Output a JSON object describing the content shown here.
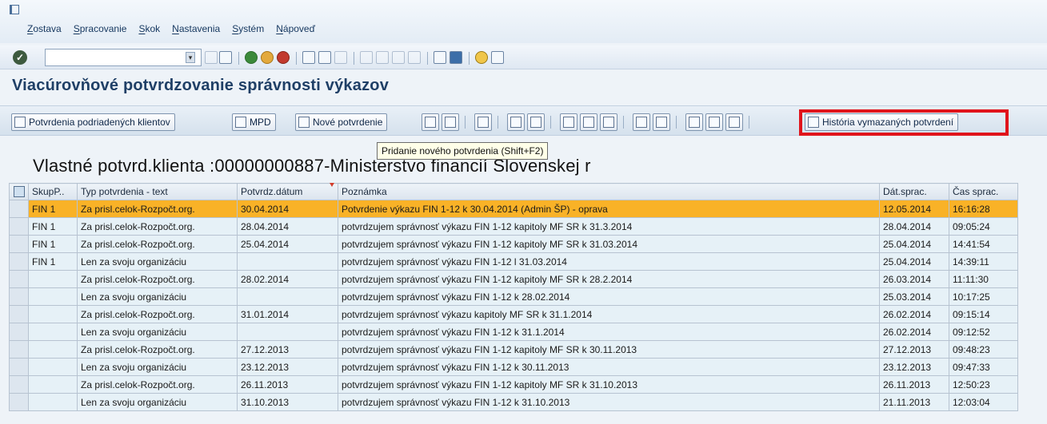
{
  "menu": [
    "Zostava",
    "Spracovanie",
    "Skok",
    "Nastavenia",
    "Systém",
    "Nápoveď"
  ],
  "command_field": {
    "value": ""
  },
  "title": "Viacúrovňové potvrdzovanie správnosti výkazov",
  "app_toolbar": {
    "btn_sub_clients": "Potvrdenia podriadených klientov",
    "btn_mpd": "MPD",
    "btn_new": "Nové potvrdenie",
    "btn_history": "História vymazaných potvrdení"
  },
  "tooltip": "Pridanie nového potvrdenia   (Shift+F2)",
  "list_heading": "Vlastné potvrd.klienta :00000000887-Ministerstvo financií Slovenskej r",
  "table": {
    "headers": [
      "SkupP..",
      "Typ potvrdenia - text",
      "Potvrdz.dátum",
      "Poznámka",
      "Dát.sprac.",
      "Čas sprac."
    ],
    "rows": [
      [
        "FIN 1",
        "Za prisl.celok-Rozpočt.org.",
        "30.04.2014",
        "Potvrdenie výkazu FIN 1-12 k 30.04.2014 (Admin ŠP) - oprava",
        "12.05.2014",
        "16:16:28"
      ],
      [
        "FIN 1",
        "Za prisl.celok-Rozpočt.org.",
        "28.04.2014",
        "potvrdzujem správnosť výkazu FIN 1-12 kapitoly MF SR k 31.3.2014",
        "28.04.2014",
        "09:05:24"
      ],
      [
        "FIN 1",
        "Za prisl.celok-Rozpočt.org.",
        "25.04.2014",
        "potvrdzujem správnosť výkazu FIN 1-12 kapitoly MF SR k 31.03.2014",
        "25.04.2014",
        "14:41:54"
      ],
      [
        "FIN 1",
        "Len za svoju organizáciu",
        "",
        "potvrdzujem správnosť výkazu FIN 1-12 l 31.03.2014",
        "25.04.2014",
        "14:39:11"
      ],
      [
        "",
        "Za prisl.celok-Rozpočt.org.",
        "28.02.2014",
        "potvrdzujem správnosť výkazu FIN 1-12 kapitoly MF SR k 28.2.2014",
        "26.03.2014",
        "11:11:30"
      ],
      [
        "",
        "Len za svoju organizáciu",
        "",
        "potvrdzujem správnosť výkazu FIN 1-12 k 28.02.2014",
        "25.03.2014",
        "10:17:25"
      ],
      [
        "",
        "Za prisl.celok-Rozpočt.org.",
        "31.01.2014",
        "potvrdzujem správnosť výkazu kapitoly MF SR k 31.1.2014",
        "26.02.2014",
        "09:15:14"
      ],
      [
        "",
        "Len za svoju organizáciu",
        "",
        "potvrdzujem správnosť výkazu FIN 1-12 k 31.1.2014",
        "26.02.2014",
        "09:12:52"
      ],
      [
        "",
        "Za prisl.celok-Rozpočt.org.",
        "27.12.2013",
        "potvrdzujem správnosť výkazu FIN 1-12 kapitoly MF SR k 30.11.2013",
        "27.12.2013",
        "09:48:23"
      ],
      [
        "",
        "Len za svoju organizáciu",
        "23.12.2013",
        "potvrdzujem správnosť výkazu FIN 1-12 k 30.11.2013",
        "23.12.2013",
        "09:47:33"
      ],
      [
        "",
        "Za prisl.celok-Rozpočt.org.",
        "26.11.2013",
        "potvrdzujem správnosť výkazu FIN 1-12 kapitoly MF SR k 31.10.2013",
        "26.11.2013",
        "12:50:23"
      ],
      [
        "",
        "Len za svoju organizáciu",
        "31.10.2013",
        "potvrdzujem správnosť výkazu FIN 1-12 k 31.10.2013",
        "21.11.2013",
        "12:03:04"
      ]
    ]
  },
  "colors": {
    "selected_row": "#f9b227",
    "highlight_box": "#e0141b",
    "title": "#1f3f66"
  }
}
